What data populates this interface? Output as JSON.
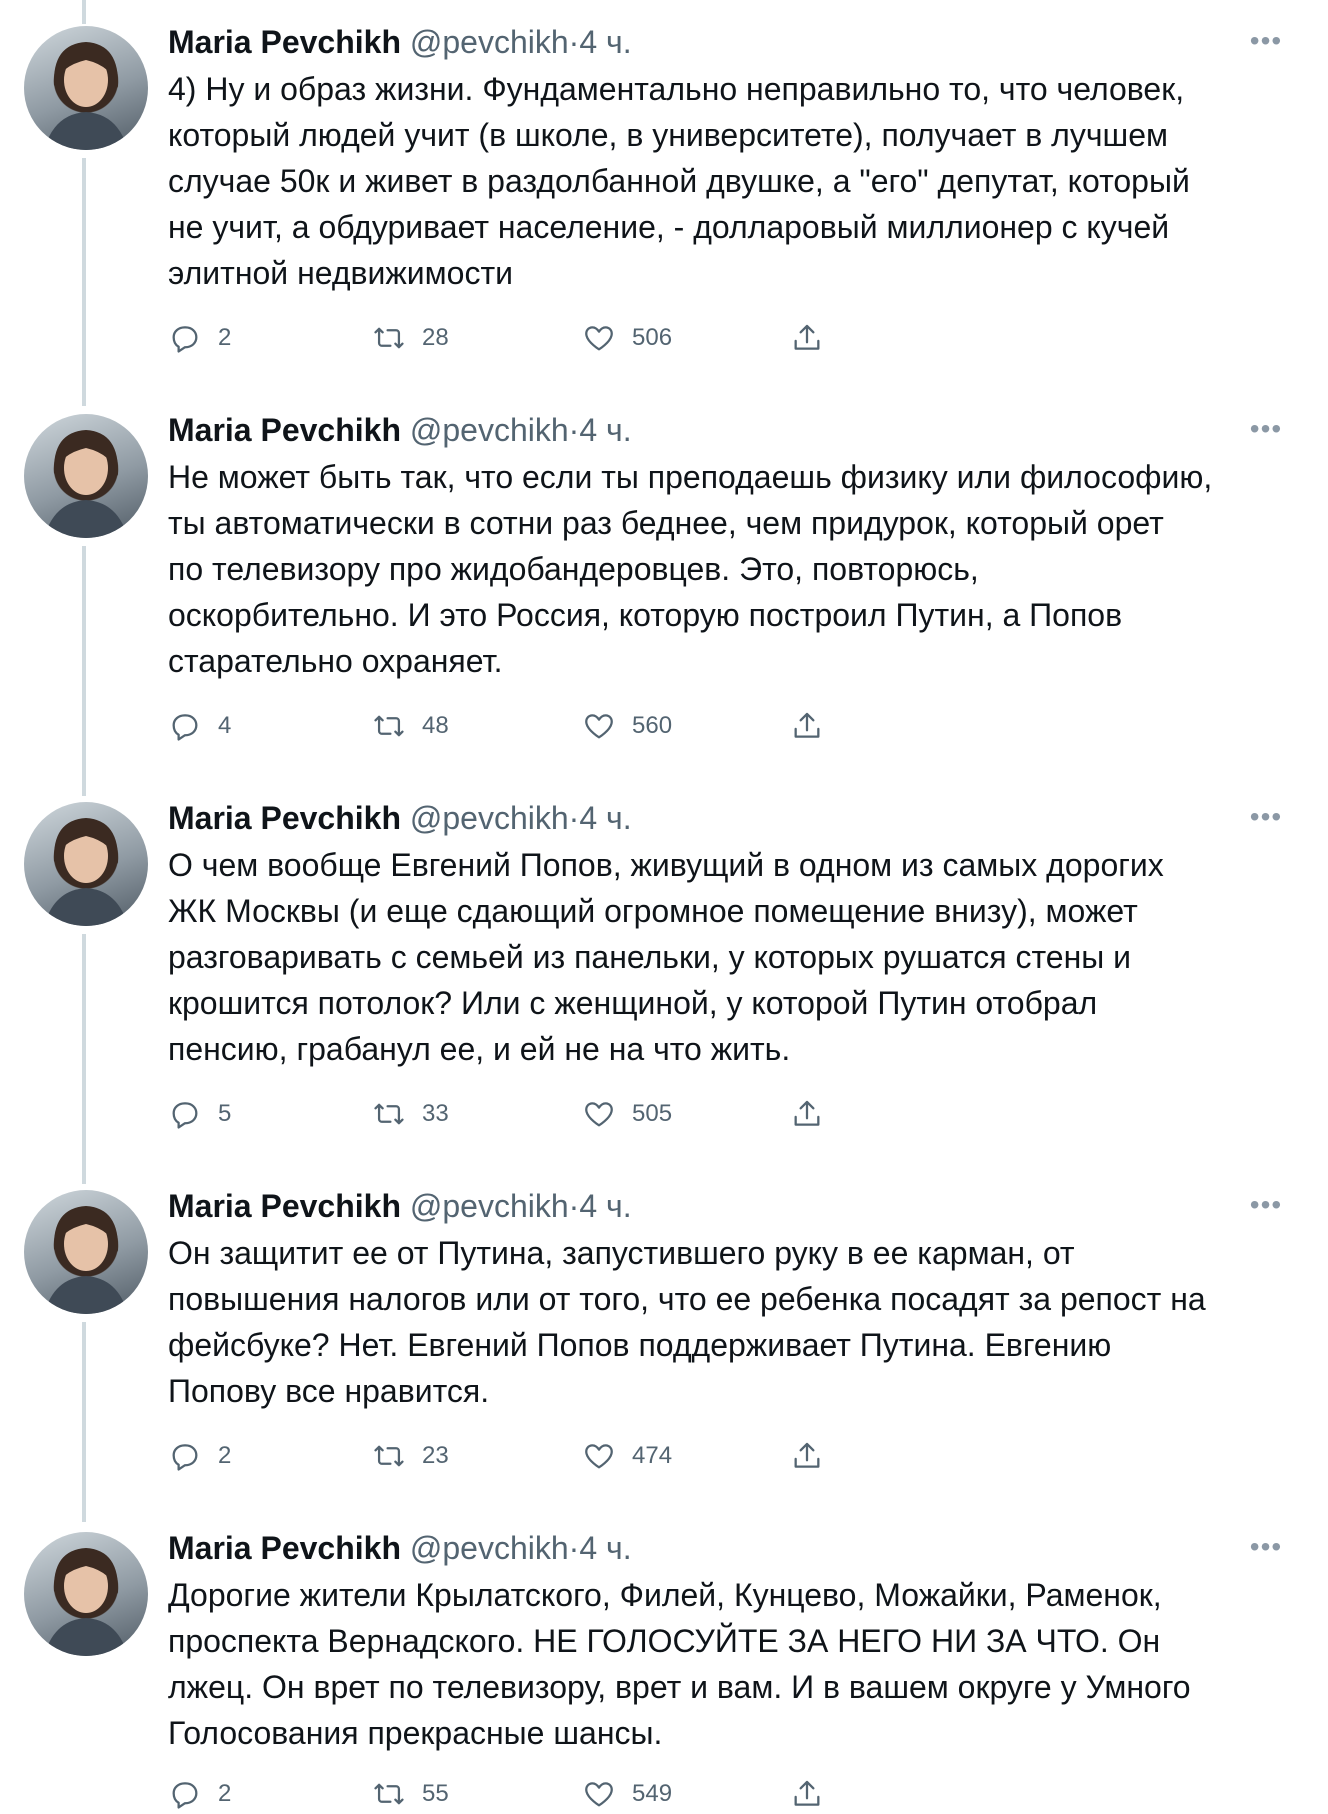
{
  "colors": {
    "text": "#0f1419",
    "muted": "#536471",
    "thread_line": "#cfd9de"
  },
  "icons": {
    "reply": "speech-bubble-icon",
    "retweet": "retweet-arrows-icon",
    "like": "heart-icon",
    "share": "upload-share-icon",
    "more": "ellipsis-icon"
  },
  "tweets": [
    {
      "name": "Maria Pevchikh",
      "handle": "@pevchikh",
      "sep": "·",
      "time": "4 ч.",
      "more": "•••",
      "text": "4) Ну и образ жизни. Фундаментально неправильно то, что человек, \nкоторый людей учит (в школе, в университете), получает в лучшем \nслучае 50к и живет в раздолбанной двушке, а \"его\" депутат, который \nне учит, а обдуривает население, - долларовый миллионер с кучей \nэлитной недвижимости",
      "replies": "2",
      "retweets": "28",
      "likes": "506"
    },
    {
      "name": "Maria Pevchikh",
      "handle": "@pevchikh",
      "sep": "·",
      "time": "4 ч.",
      "more": "•••",
      "text": "Не может быть так, что если ты преподаешь физику или философию, \nты автоматически в сотни раз беднее, чем придурок, который орет \nпо телевизору про жидобандеровцев. Это, повторюсь, \nоскорбительно. И это Россия, которую построил Путин, а Попов \nстарательно охраняет.",
      "replies": "4",
      "retweets": "48",
      "likes": "560"
    },
    {
      "name": "Maria Pevchikh",
      "handle": "@pevchikh",
      "sep": "·",
      "time": "4 ч.",
      "more": "•••",
      "text": "О чем вообще Евгений Попов, живущий в одном из самых дорогих \nЖК Москвы (и еще сдающий огромное помещение внизу), может \nразговаривать с семьей из панельки, у которых рушатся стены и \nкрошится потолок? Или с женщиной, у которой Путин отобрал \nпенсию, грабанул ее, и ей не на что жить.",
      "replies": "5",
      "retweets": "33",
      "likes": "505"
    },
    {
      "name": "Maria Pevchikh",
      "handle": "@pevchikh",
      "sep": "·",
      "time": "4 ч.",
      "more": "•••",
      "text": "Он защитит ее от Путина, запустившего руку в ее карман, от \nповышения налогов или от того, что ее ребенка посадят за репост на \nфейсбуке? Нет. Евгений Попов поддерживает Путина. Евгению \nПопову все нравится.",
      "replies": "2",
      "retweets": "23",
      "likes": "474"
    },
    {
      "name": "Maria Pevchikh",
      "handle": "@pevchikh",
      "sep": "·",
      "time": "4 ч.",
      "more": "•••",
      "text": "Дорогие жители Крылатского, Филей, Кунцево, Можайки, Раменок, \nпроспекта Вернадского. НЕ ГОЛОСУЙТЕ ЗА НЕГО НИ ЗА ЧТО. Он \nлжец. Он врет по телевизору, врет и вам. И в вашем округе у Умного \nГолосования прекрасные шансы.",
      "replies": "2",
      "retweets": "55",
      "likes": "549"
    }
  ]
}
